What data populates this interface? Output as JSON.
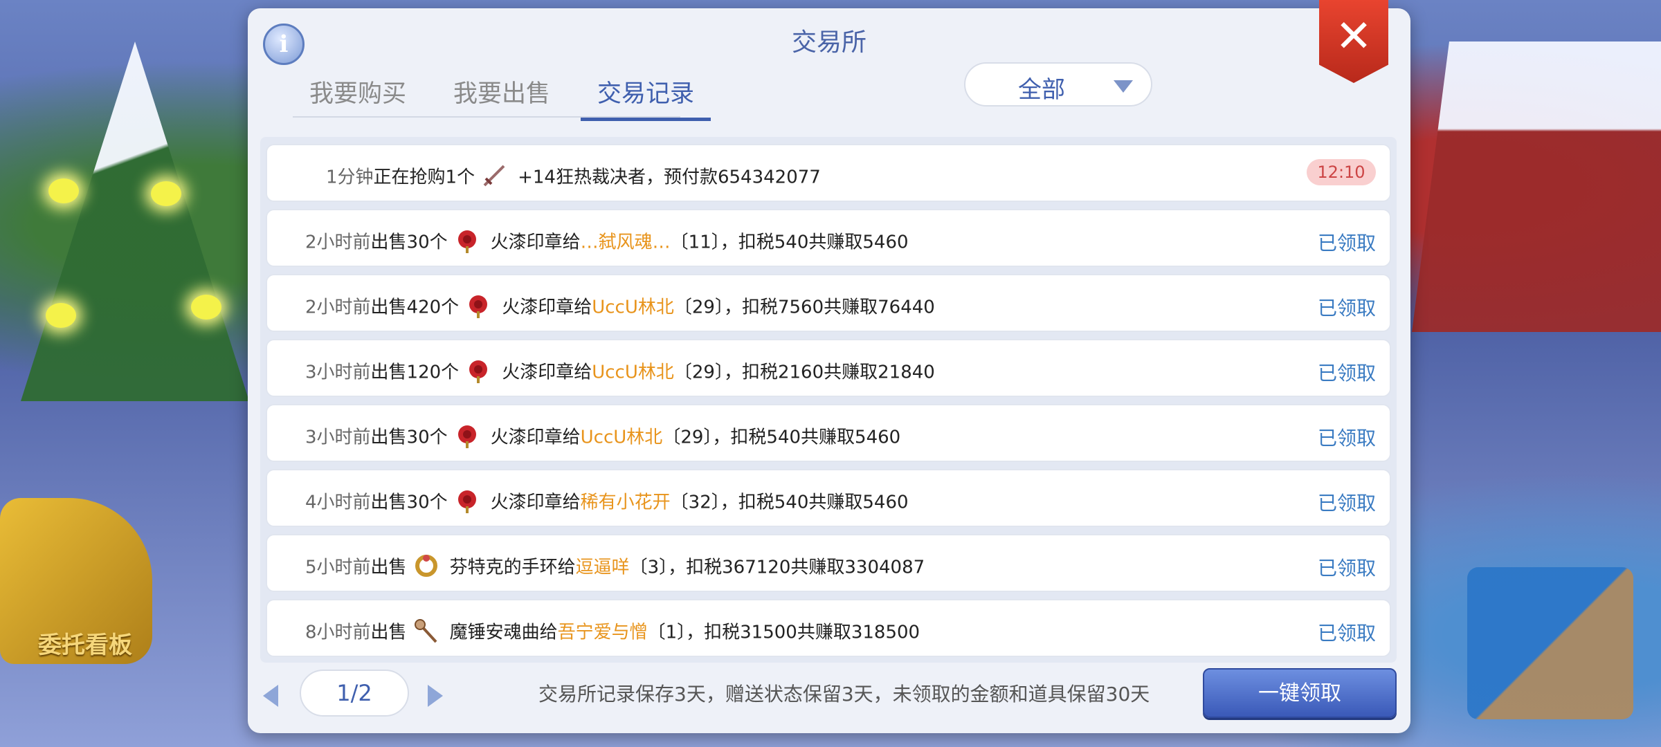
{
  "hud": {
    "board_label": "委托看板"
  },
  "dialog": {
    "title": "交易所",
    "tabs": [
      {
        "label": "我要购买",
        "active": false
      },
      {
        "label": "我要出售",
        "active": false
      },
      {
        "label": "交易记录",
        "active": true
      }
    ],
    "filter": {
      "selected": "全部"
    }
  },
  "records": [
    {
      "time": "1分钟",
      "action": "正在抢购1个",
      "icon": "sword-icon",
      "item": "+14狂热裁决者，预付款654342077",
      "status": "12:10"
    },
    {
      "time": "2小时前",
      "action": "出售30个",
      "icon": "rose-seal-icon",
      "item": "火漆印章给",
      "player": "…弑风魂…",
      "detail": "〔11〕，扣税540共赚取5460",
      "status": "已领取"
    },
    {
      "time": "2小时前",
      "action": "出售420个",
      "icon": "rose-seal-icon",
      "item": "火漆印章给",
      "player": "UccU林北",
      "detail": "〔29〕，扣税7560共赚取76440",
      "status": "已领取"
    },
    {
      "time": "3小时前",
      "action": "出售120个",
      "icon": "rose-seal-icon",
      "item": "火漆印章给",
      "player": "UccU林北",
      "detail": "〔29〕，扣税2160共赚取21840",
      "status": "已领取"
    },
    {
      "time": "3小时前",
      "action": "出售30个",
      "icon": "rose-seal-icon",
      "item": "火漆印章给",
      "player": "UccU林北",
      "detail": "〔29〕，扣税540共赚取5460",
      "status": "已领取"
    },
    {
      "time": "4小时前",
      "action": "出售30个",
      "icon": "rose-seal-icon",
      "item": "火漆印章给",
      "player": "稀有小花开",
      "detail": "〔32〕，扣税540共赚取5460",
      "status": "已领取"
    },
    {
      "time": "5小时前",
      "action": "出售",
      "icon": "bracelet-icon",
      "item": "芬特克的手环给",
      "player": "逗逼咩",
      "detail": "〔3〕，扣税367120共赚取3304087",
      "status": "已领取"
    },
    {
      "time": "8小时前",
      "action": "出售",
      "icon": "hammer-icon",
      "item": "魔锤安魂曲给",
      "player": "吾宁爱与憎",
      "detail": "〔1〕，扣税31500共赚取318500",
      "status": "已领取"
    }
  ],
  "footer": {
    "page": "1/2",
    "notice": "交易所记录保存3天，赠送状态保留3天，未领取的金额和道具保留30天",
    "claim_all_label": "一键领取"
  }
}
